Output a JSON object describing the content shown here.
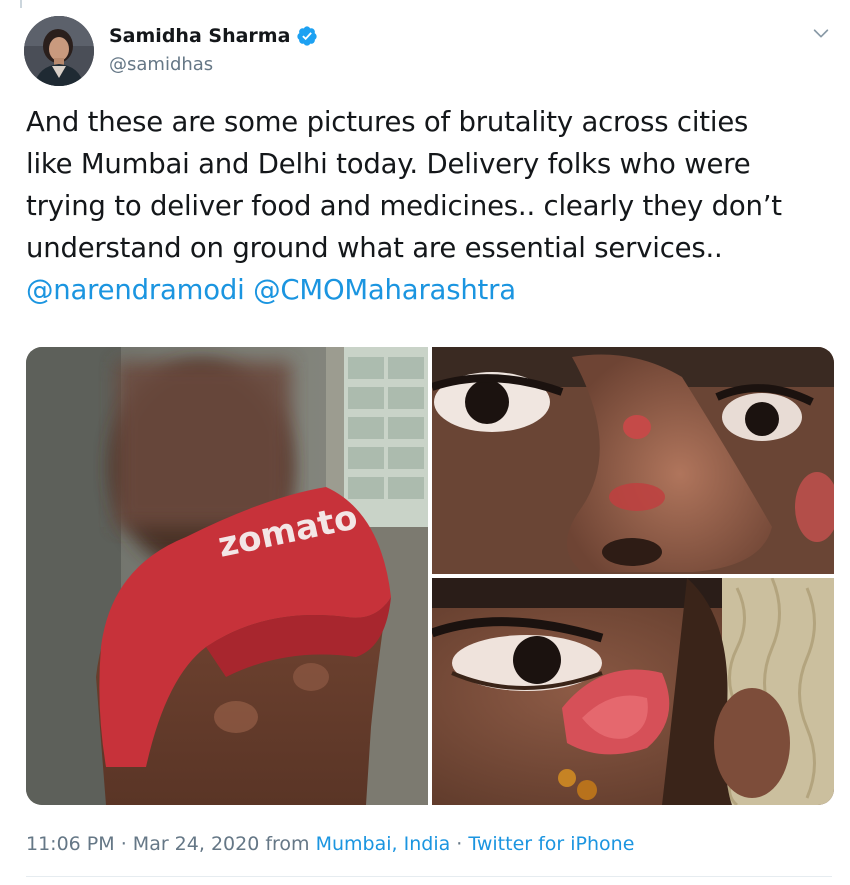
{
  "author": {
    "display_name": "Samidha Sharma",
    "handle": "@samidhas",
    "verified": true,
    "avatar_icon": "profile-photo"
  },
  "tweet": {
    "lines": [
      "And these are some pictures of brutality across cities",
      "like Mumbai and Delhi today. Delivery folks who were",
      "trying to deliver food and medicines.. clearly they don’t",
      "understand on ground what are essential services.."
    ],
    "mentions": [
      "@narendramodi",
      "@CMOMaharashtra"
    ]
  },
  "media": {
    "photo_count": 3,
    "shirt_text": "zomato"
  },
  "footer": {
    "time": "11:06 PM",
    "separator": "·",
    "date": "Mar 24, 2020",
    "from_label": "from",
    "location": "Mumbai, India",
    "source": "Twitter for iPhone"
  },
  "colors": {
    "link": "#1b95e0",
    "verified_badge": "#1da1f2",
    "secondary_text": "#657786"
  }
}
